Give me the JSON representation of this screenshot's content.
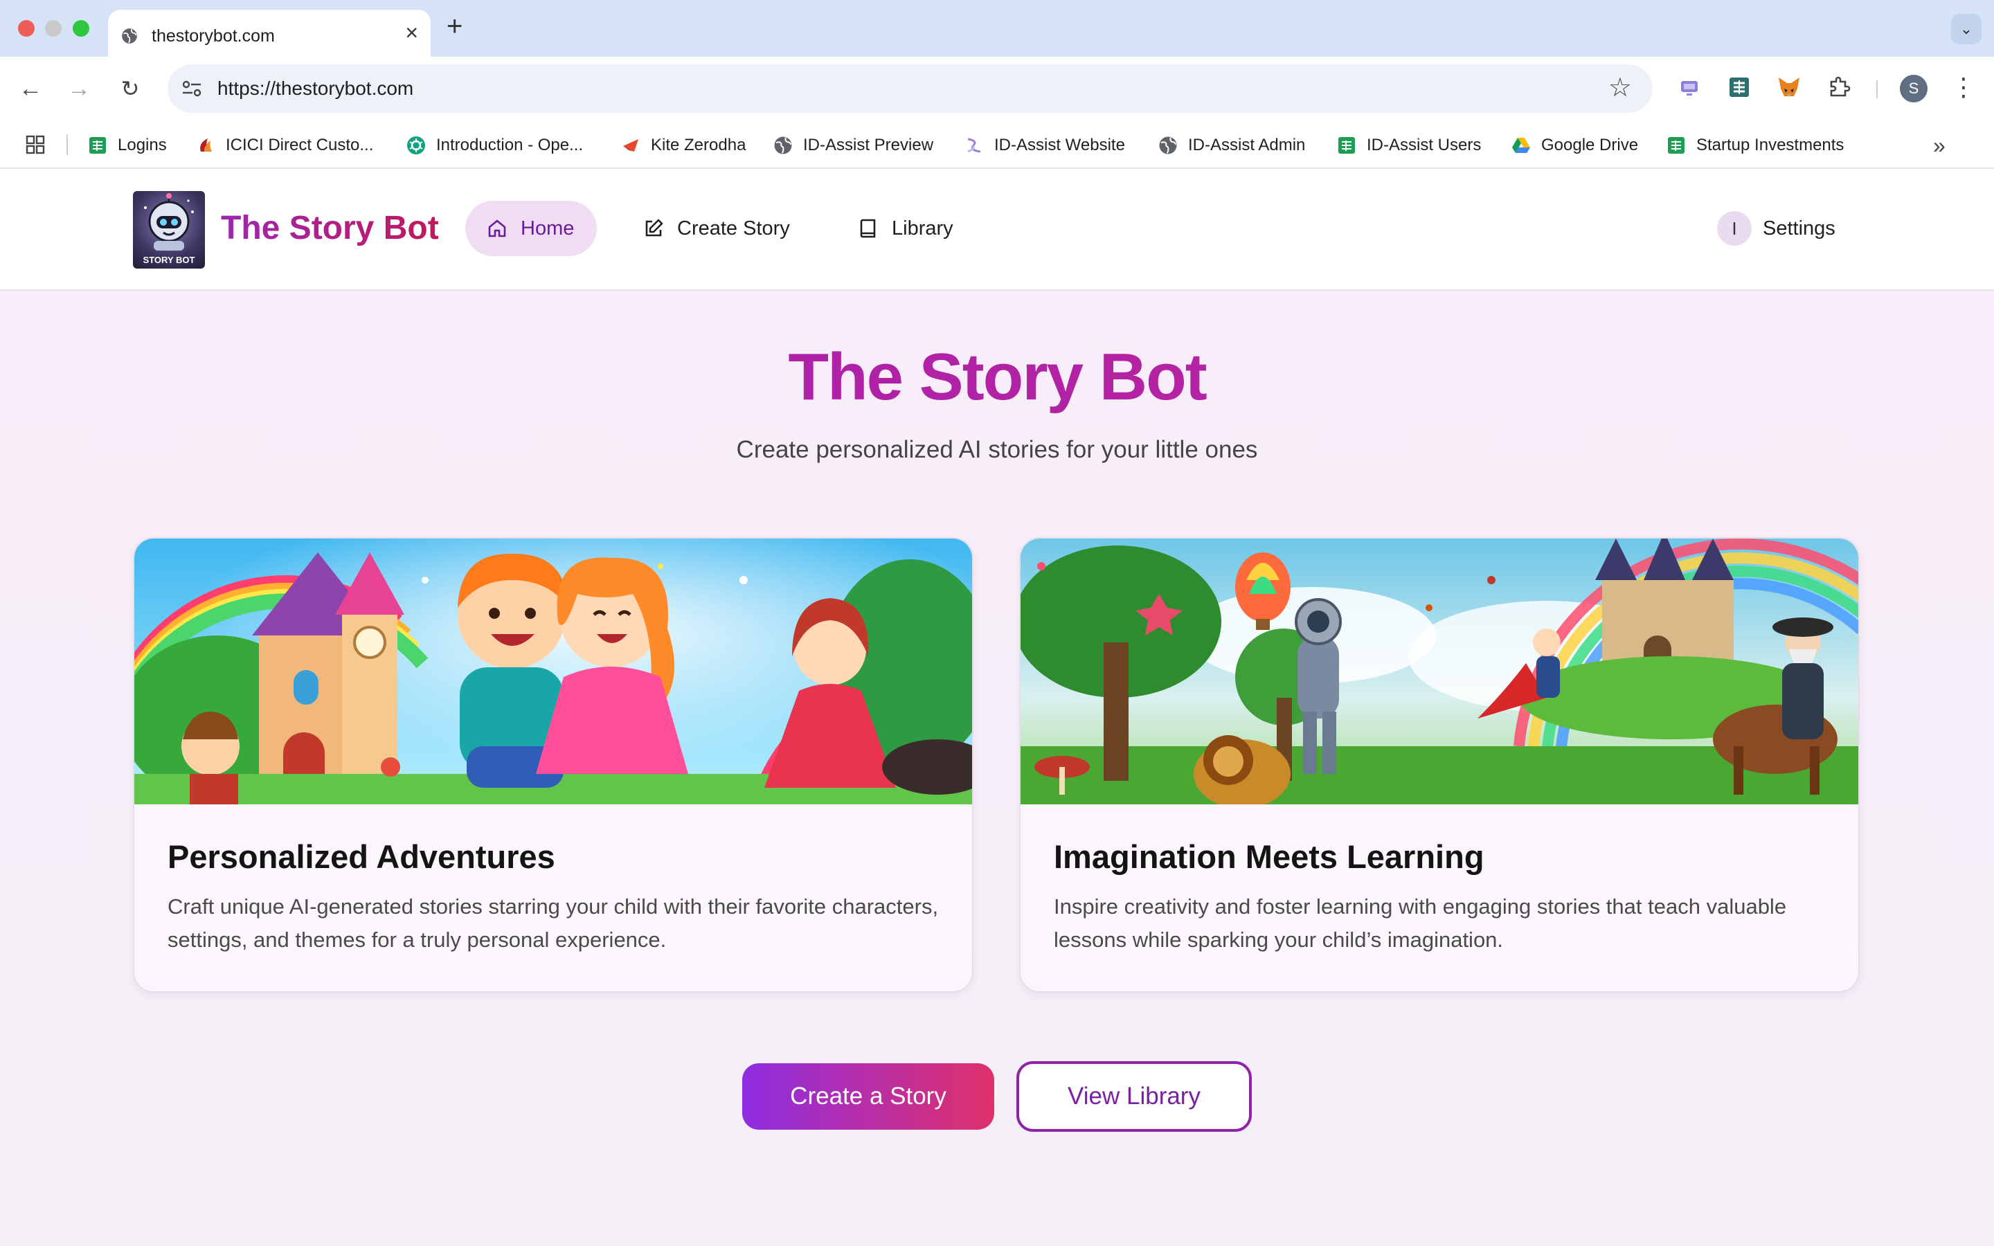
{
  "browser": {
    "tab_title": "thestorybot.com",
    "url": "https://thestorybot.com",
    "profile_initial": "S",
    "bookmarks": [
      {
        "label": "Logins",
        "icon": "sheets-icon"
      },
      {
        "label": "ICICI Direct Custo...",
        "icon": "icici-icon"
      },
      {
        "label": "Introduction - Ope...",
        "icon": "openai-icon"
      },
      {
        "label": "Kite Zerodha",
        "icon": "kite-icon"
      },
      {
        "label": "ID-Assist Preview",
        "icon": "globe-icon"
      },
      {
        "label": "ID-Assist Website",
        "icon": "id-assist-icon"
      },
      {
        "label": "ID-Assist Admin",
        "icon": "globe-icon"
      },
      {
        "label": "ID-Assist Users",
        "icon": "sheets-icon"
      },
      {
        "label": "Google Drive",
        "icon": "google-drive-icon"
      },
      {
        "label": "Startup Investments",
        "icon": "sheets-icon"
      }
    ]
  },
  "site": {
    "logo_text": "The Story Bot",
    "logo_badge": "STORY BOT",
    "nav": {
      "home": "Home",
      "create": "Create Story",
      "library": "Library"
    },
    "settings_initial": "I",
    "settings_label": "Settings"
  },
  "hero": {
    "title": "The Story Bot",
    "subtitle": "Create personalized AI stories for your little ones"
  },
  "cards": [
    {
      "title": "Personalized Adventures",
      "description": "Craft unique AI-generated stories starring your child with their favorite characters, settings, and themes for a truly personal experience."
    },
    {
      "title": "Imagination Meets Learning",
      "description": "Inspire creativity and foster learning with engaging stories that teach valuable lessons while sparking your child’s imagination."
    }
  ],
  "actions": {
    "create": "Create a Story",
    "library": "View Library"
  },
  "colors": {
    "brand_purple": "#9c27b0",
    "brand_pink": "#c2185b",
    "primary_gradient_start": "#8e2de2",
    "primary_gradient_end": "#e0306a"
  }
}
